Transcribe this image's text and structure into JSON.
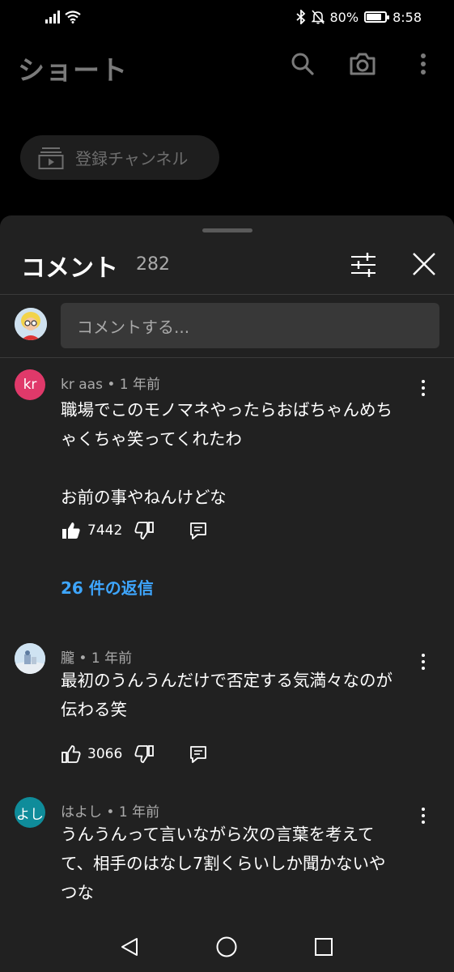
{
  "status_bar": {
    "battery_percent": "80%",
    "battery_level": 0.8,
    "time": "8:58"
  },
  "header": {
    "title": "ショート",
    "icons": [
      "search-icon",
      "camera-icon",
      "more-vert-icon"
    ]
  },
  "subscriptions_chip": {
    "icon": "subscriptions-icon",
    "label": "登録チャンネル"
  },
  "comments_sheet": {
    "title": "コメント",
    "count": "282",
    "input_placeholder": "コメントする...",
    "comments": [
      {
        "avatar_text": "kr",
        "avatar_color": "#e0396a",
        "author": "kr aas",
        "time": "1 年前",
        "text_lines": [
          "職場でこのモノマネやったらおばちゃんめち",
          "ゃくちゃ笑ってくれたわ",
          "",
          "お前の事やねんけどな"
        ],
        "likes": "7442",
        "liked": true,
        "replies_label": "26 件の返信"
      },
      {
        "avatar_text": "",
        "avatar_color": "#cfe3f2",
        "author": "朧",
        "time": "1 年前",
        "text_lines": [
          "最初のうんうんだけで否定する気満々なのが",
          "伝わる笑"
        ],
        "likes": "3066",
        "liked": false
      },
      {
        "avatar_text": "よし",
        "avatar_color": "#0f8c9a",
        "author": "はよし",
        "time": "1 年前",
        "text_lines": [
          "うんうんって言いながら次の言葉を考えて",
          "て、相手のはなし7割くらいしか聞かないや",
          "つな"
        ]
      }
    ]
  },
  "nav": {
    "icons": [
      "back-icon",
      "home-icon",
      "recents-icon"
    ]
  }
}
